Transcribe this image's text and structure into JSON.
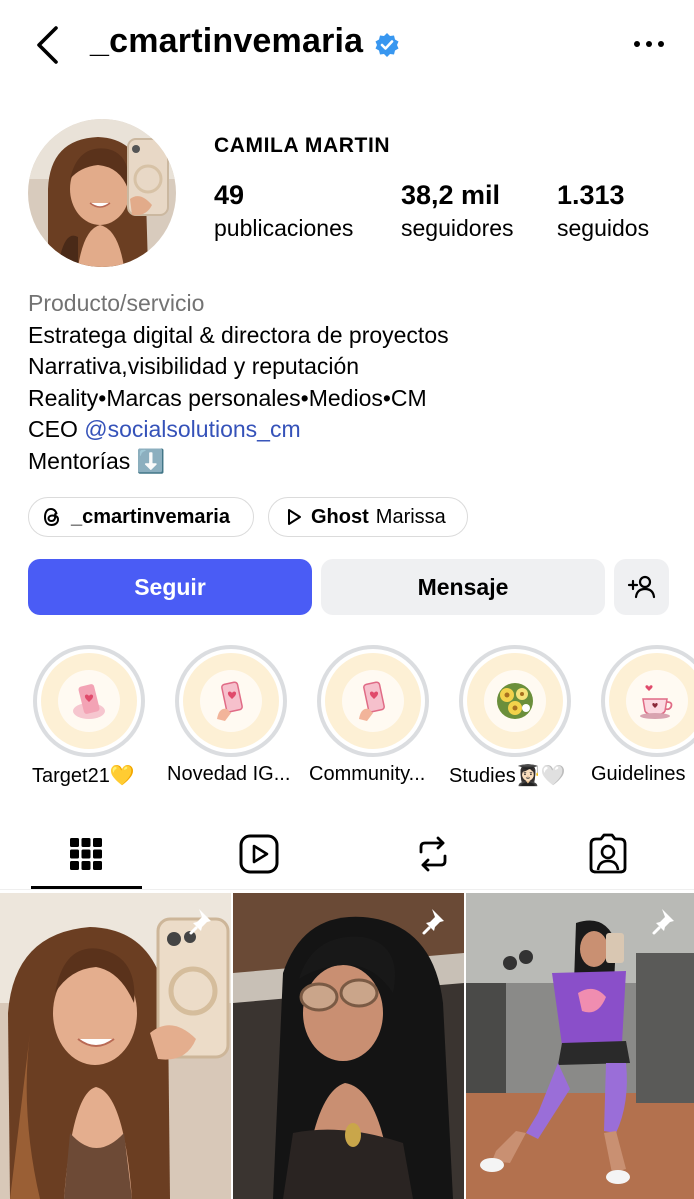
{
  "header": {
    "username": "_cmartinvemaria"
  },
  "profile": {
    "display_name": "CAMILA MARTIN",
    "stats": [
      {
        "value": "49",
        "label": "publicaciones"
      },
      {
        "value": "38,2 mil",
        "label": "seguidores"
      },
      {
        "value": "1.313",
        "label": "seguidos"
      }
    ],
    "category": "Producto/servicio",
    "bio_lines": [
      "Estratega digital & directora de proyectos",
      "Narrativa,visibilidad y reputación",
      "Reality•Marcas personales•Medios•CM"
    ],
    "ceo_prefix": "CEO ",
    "ceo_mention": "@socialsolutions_cm",
    "mentorias": "Mentorías ⬇️",
    "threads_chip": "_cmartinvemaria",
    "music_song": "Ghost",
    "music_artist": "Marissa",
    "accent_color": "#4a5cf5",
    "mention_color": "#3552b9"
  },
  "actions": {
    "follow_label": "Seguir",
    "message_label": "Mensaje"
  },
  "highlights": [
    {
      "label": "Target21💛",
      "icon": "phone-heart-icon"
    },
    {
      "label": "Novedad IG...",
      "icon": "phone-hand-icon"
    },
    {
      "label": "Community...",
      "icon": "phone-hand-icon"
    },
    {
      "label": "Studies👩🏻‍🎓🤍",
      "icon": "flowers-icon"
    },
    {
      "label": "Guidelines",
      "icon": "teacup-icon"
    }
  ],
  "tabs": [
    "grid-icon",
    "reels-icon",
    "reposts-icon",
    "tagged-icon"
  ],
  "posts": [
    {
      "type": "photo",
      "pinned": true
    },
    {
      "type": "photo",
      "pinned": true
    },
    {
      "type": "photo",
      "pinned": true
    }
  ]
}
